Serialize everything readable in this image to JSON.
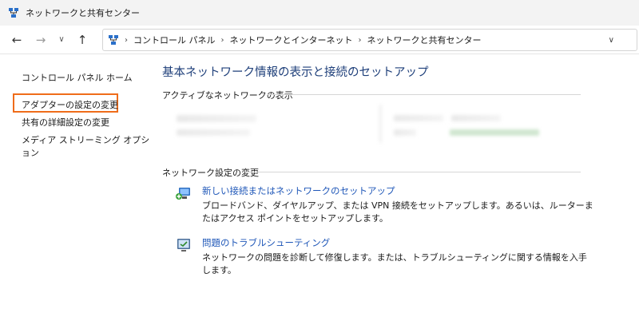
{
  "window": {
    "title": "ネットワークと共有センター",
    "icon": "network-center-icon"
  },
  "nav": {
    "back_icon": "arrow-left-icon",
    "forward_icon": "arrow-right-icon",
    "history_icon": "chevron-down-icon",
    "up_icon": "arrow-up-icon",
    "separator": "›",
    "breadcrumbs": [
      "コントロール パネル",
      "ネットワークとインターネット",
      "ネットワークと共有センター"
    ],
    "dropdown_icon": "chevron-down-icon"
  },
  "sidebar": {
    "home": "コントロール パネル ホーム",
    "links": [
      "アダプターの設定の変更",
      "共有の詳細設定の変更",
      "メディア ストリーミング オプション"
    ],
    "highlight_color": "#ef6c1a"
  },
  "main": {
    "heading": "基本ネットワーク情報の表示と接続のセットアップ",
    "active_section": "アクティブなネットワークの表示",
    "change_section": "ネットワーク設定の変更",
    "tasks": [
      {
        "icon": "new-connection-icon",
        "link": "新しい接続またはネットワークのセットアップ",
        "desc": "ブロードバンド、ダイヤルアップ、または VPN 接続をセットアップします。あるいは、ルーターまたはアクセス ポイントをセットアップします。"
      },
      {
        "icon": "troubleshoot-icon",
        "link": "問題のトラブルシューティング",
        "desc": "ネットワークの問題を診断して修復します。または、トラブルシューティングに関する情報を入手します。"
      }
    ]
  },
  "colors": {
    "link": "#1f57b8",
    "heading": "#1e3f7a"
  }
}
